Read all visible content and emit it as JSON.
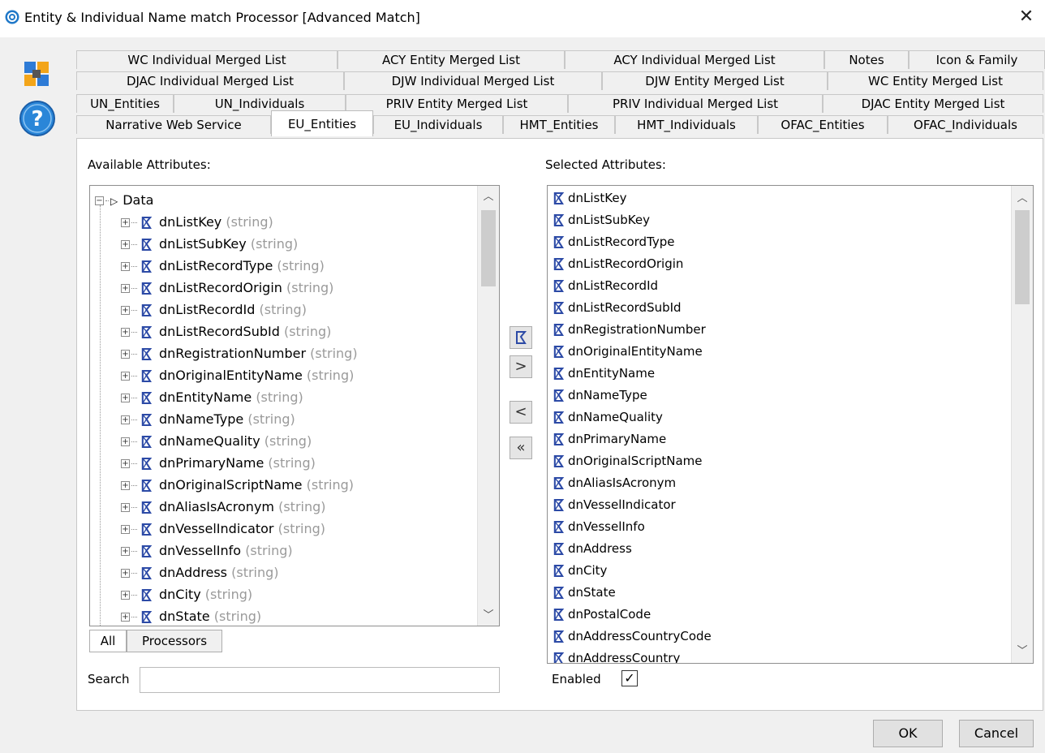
{
  "window": {
    "title": "Entity & Individual Name match Processor [Advanced Match]",
    "close_glyph": "✕"
  },
  "icons": {
    "app": "swirl-app-icon",
    "family": "family-blocks-icon",
    "help": "help-question-icon"
  },
  "tab_rows": [
    [
      {
        "label": "WC Individual Merged List",
        "w": 322
      },
      {
        "label": "ACY Entity Merged List",
        "w": 280
      },
      {
        "label": "ACY Individual Merged List",
        "w": 320
      },
      {
        "label": "Notes",
        "w": 104
      },
      {
        "label": "Icon & Family",
        "w": 168
      }
    ],
    [
      {
        "label": "DJAC Individual Merged List",
        "w": 330
      },
      {
        "label": "DJW Individual Merged List",
        "w": 318
      },
      {
        "label": "DJW Entity Merged List",
        "w": 278
      },
      {
        "label": "WC Entity Merged List",
        "w": 266
      }
    ],
    [
      {
        "label": "UN_Entities",
        "w": 120
      },
      {
        "label": "UN_Individuals",
        "w": 212
      },
      {
        "label": "PRIV Entity Merged List",
        "w": 274
      },
      {
        "label": "PRIV Individual Merged List",
        "w": 314
      },
      {
        "label": "DJAC Entity Merged List",
        "w": 272
      }
    ],
    [
      {
        "label": "Narrative Web Service",
        "w": 240
      },
      {
        "label": "EU_Entities",
        "w": 126,
        "active": true
      },
      {
        "label": "EU_Individuals",
        "w": 160
      },
      {
        "label": "HMT_Entities",
        "w": 138
      },
      {
        "label": "HMT_Individuals",
        "w": 176
      },
      {
        "label": "OFAC_Entities",
        "w": 160
      },
      {
        "label": "OFAC_Individuals",
        "w": 192
      }
    ]
  ],
  "available": {
    "label": "Available Attributes:",
    "root": "Data",
    "type_suffix": "(string)",
    "items": [
      "dnListKey",
      "dnListSubKey",
      "dnListRecordType",
      "dnListRecordOrigin",
      "dnListRecordId",
      "dnListRecordSubId",
      "dnRegistrationNumber",
      "dnOriginalEntityName",
      "dnEntityName",
      "dnNameType",
      "dnNameQuality",
      "dnPrimaryName",
      "dnOriginalScriptName",
      "dnAliasIsAcronym",
      "dnVesselIndicator",
      "dnVesselInfo",
      "dnAddress",
      "dnCity",
      "dnState"
    ]
  },
  "selected": {
    "label": "Selected Attributes:",
    "items": [
      "dnListKey",
      "dnListSubKey",
      "dnListRecordType",
      "dnListRecordOrigin",
      "dnListRecordId",
      "dnListRecordSubId",
      "dnRegistrationNumber",
      "dnOriginalEntityName",
      "dnEntityName",
      "dnNameType",
      "dnNameQuality",
      "dnPrimaryName",
      "dnOriginalScriptName",
      "dnAliasIsAcronym",
      "dnVesselIndicator",
      "dnVesselInfo",
      "dnAddress",
      "dnCity",
      "dnState",
      "dnPostalCode",
      "dnAddressCountryCode",
      "dnAddressCountry"
    ]
  },
  "move_buttons": {
    "add_right": ">",
    "remove_left": "<",
    "remove_all": "«"
  },
  "subtabs": {
    "all": "All",
    "processors": "Processors"
  },
  "search": {
    "label": "Search",
    "value": ""
  },
  "enabled": {
    "label": "Enabled",
    "checked": true,
    "check_glyph": "✓"
  },
  "buttons": {
    "ok": "OK",
    "cancel": "Cancel"
  },
  "colors": {
    "attr_icon": "#2c4aa6",
    "type_gray": "#9a9a9a",
    "help_blue": "#2a86d8"
  }
}
